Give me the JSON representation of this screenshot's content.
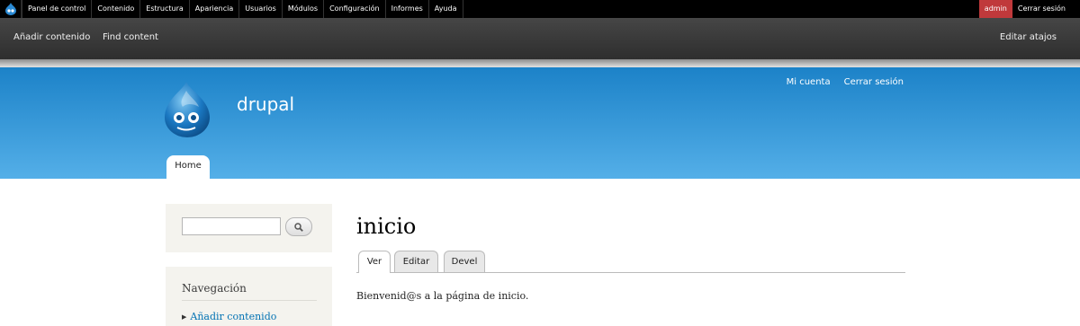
{
  "toolbar": {
    "menu": [
      "Panel de control",
      "Contenido",
      "Estructura",
      "Apariencia",
      "Usuarios",
      "Módulos",
      "Configuración",
      "Informes",
      "Ayuda"
    ],
    "user": "admin",
    "logout": "Cerrar sesión",
    "shortcuts": [
      "Añadir contenido",
      "Find content"
    ],
    "edit_shortcuts": "Editar atajos"
  },
  "header": {
    "site_name": "drupal",
    "secondary_menu": [
      "Mi cuenta",
      "Cerrar sesión"
    ],
    "main_tab": "Home"
  },
  "sidebar": {
    "navigation_title": "Navegación",
    "navigation_items": [
      "Añadir contenido"
    ]
  },
  "main": {
    "title": "inicio",
    "tabs": [
      "Ver",
      "Editar",
      "Devel"
    ],
    "body": "Bienvenid@s a la página de inicio."
  },
  "colors": {
    "toolbar_bg": "#000000",
    "user_badge": "#c0393b",
    "header_top": "#1c82c8",
    "header_bottom": "#54afe8",
    "link": "#0071b3"
  },
  "icons": {
    "toolbar_home": "drupal-drop-icon",
    "logo": "drupal-logo-icon",
    "search": "search-icon",
    "nav_bullet": "triangle-right-icon"
  }
}
